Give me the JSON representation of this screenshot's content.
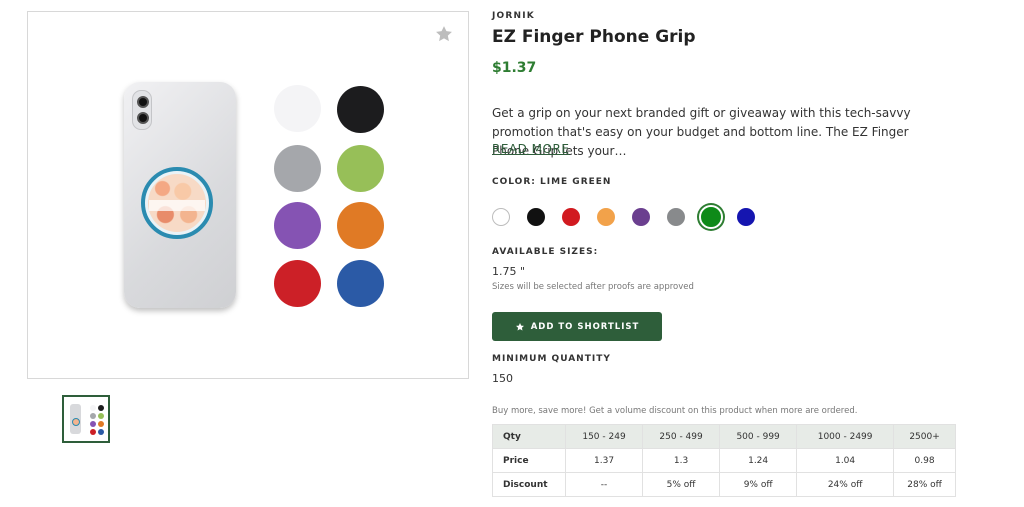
{
  "gallery": {
    "swatches": [
      "#f4f4f6",
      "#1c1c1e",
      "#a5a7ab",
      "#97bf58",
      "#8553b3",
      "#e07a25",
      "#cc2027",
      "#2b5aa6"
    ],
    "grip_print_text": "playfulmermaid"
  },
  "product": {
    "brand": "JORNIK",
    "title": "EZ Finger Phone Grip",
    "price": "$1.37",
    "description": "Get a grip on your next branded gift or giveaway with this tech-savvy promotion that's easy on your budget and bottom line. The EZ Finger Phone Grip lets your…",
    "read_more": "READ MORE"
  },
  "color": {
    "label": "COLOR: LIME GREEN",
    "options": [
      {
        "name": "White",
        "hex": "#ffffff"
      },
      {
        "name": "Black",
        "hex": "#111111"
      },
      {
        "name": "Red",
        "hex": "#d11a20"
      },
      {
        "name": "Orange",
        "hex": "#f2a24a"
      },
      {
        "name": "Purple",
        "hex": "#6b3f8f"
      },
      {
        "name": "Gray",
        "hex": "#888a8c"
      },
      {
        "name": "Lime Green",
        "hex": "#0e8a18",
        "selected": true
      },
      {
        "name": "Blue",
        "hex": "#1515b0"
      }
    ]
  },
  "sizes": {
    "label": "AVAILABLE SIZES:",
    "value": "1.75 \"",
    "note": "Sizes will be selected after proofs are approved"
  },
  "shortlist_button": "ADD TO SHORTLIST",
  "minimum": {
    "label": "MINIMUM QUANTITY",
    "value": "150"
  },
  "pricing": {
    "note": "Buy more, save more! Get a volume discount on this product when more are ordered.",
    "header": [
      "Qty",
      "150 - 249",
      "250 - 499",
      "500 - 999",
      "1000 - 2499",
      "2500+"
    ],
    "price_row": [
      "Price",
      "1.37",
      "1.3",
      "1.24",
      "1.04",
      "0.98"
    ],
    "discount_row": [
      "Discount",
      "--",
      "5% off",
      "9% off",
      "24% off",
      "28% off"
    ]
  },
  "colors": {
    "accent_green": "#2e5e3a",
    "price_green": "#2e7d32"
  }
}
